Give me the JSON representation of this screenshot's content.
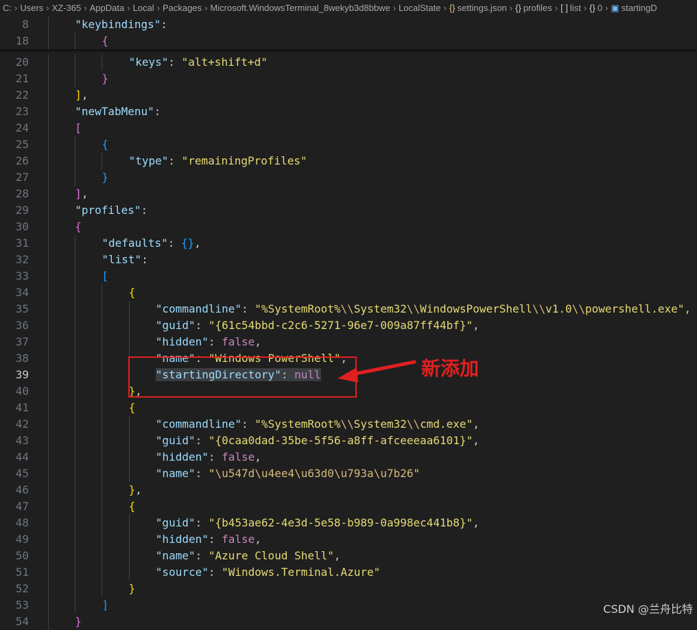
{
  "breadcrumb": {
    "items": [
      {
        "label": "C:",
        "icon": ""
      },
      {
        "label": "Users",
        "icon": ""
      },
      {
        "label": "XZ-365",
        "icon": ""
      },
      {
        "label": "AppData",
        "icon": ""
      },
      {
        "label": "Local",
        "icon": ""
      },
      {
        "label": "Packages",
        "icon": ""
      },
      {
        "label": "Microsoft.WindowsTerminal_8wekyb3d8bbwe",
        "icon": ""
      },
      {
        "label": "LocalState",
        "icon": ""
      },
      {
        "label": "settings.json",
        "icon": "json-file-icon"
      },
      {
        "label": "profiles",
        "icon": "object-icon"
      },
      {
        "label": "list",
        "icon": "array-icon"
      },
      {
        "label": "0",
        "icon": "object-icon"
      },
      {
        "label": "startingD",
        "icon": "property-icon"
      }
    ]
  },
  "sticky_lines": [
    {
      "number": "8",
      "indent": 1,
      "tokens": [
        {
          "t": "\"keybindings\"",
          "c": "k"
        },
        {
          "t": ":",
          "c": "p"
        }
      ]
    },
    {
      "number": "18",
      "indent": 2,
      "tokens": [
        {
          "t": "{",
          "c": "b2"
        }
      ]
    }
  ],
  "code_lines": [
    {
      "number": "20",
      "indent": 3,
      "tokens": [
        {
          "t": "\"keys\"",
          "c": "k"
        },
        {
          "t": ": ",
          "c": "p"
        },
        {
          "t": "\"alt+shift+d\"",
          "c": "s2"
        }
      ]
    },
    {
      "number": "21",
      "indent": 2,
      "tokens": [
        {
          "t": "}",
          "c": "b2"
        }
      ]
    },
    {
      "number": "22",
      "indent": 1,
      "tokens": [
        {
          "t": "]",
          "c": "b1"
        },
        {
          "t": ",",
          "c": "p"
        }
      ]
    },
    {
      "number": "23",
      "indent": 1,
      "tokens": [
        {
          "t": "\"newTabMenu\"",
          "c": "k"
        },
        {
          "t": ":",
          "c": "p"
        }
      ]
    },
    {
      "number": "24",
      "indent": 1,
      "tokens": [
        {
          "t": "[",
          "c": "b2"
        }
      ]
    },
    {
      "number": "25",
      "indent": 2,
      "tokens": [
        {
          "t": "{",
          "c": "b3"
        }
      ]
    },
    {
      "number": "26",
      "indent": 3,
      "tokens": [
        {
          "t": "\"type\"",
          "c": "k"
        },
        {
          "t": ": ",
          "c": "p"
        },
        {
          "t": "\"remainingProfiles\"",
          "c": "s2"
        }
      ]
    },
    {
      "number": "27",
      "indent": 2,
      "tokens": [
        {
          "t": "}",
          "c": "b3"
        }
      ]
    },
    {
      "number": "28",
      "indent": 1,
      "tokens": [
        {
          "t": "]",
          "c": "b2"
        },
        {
          "t": ",",
          "c": "p"
        }
      ]
    },
    {
      "number": "29",
      "indent": 1,
      "tokens": [
        {
          "t": "\"profiles\"",
          "c": "k"
        },
        {
          "t": ":",
          "c": "p"
        }
      ]
    },
    {
      "number": "30",
      "indent": 1,
      "tokens": [
        {
          "t": "{",
          "c": "b2"
        }
      ]
    },
    {
      "number": "31",
      "indent": 2,
      "tokens": [
        {
          "t": "\"defaults\"",
          "c": "k"
        },
        {
          "t": ": ",
          "c": "p"
        },
        {
          "t": "{}",
          "c": "b3"
        },
        {
          "t": ",",
          "c": "p"
        }
      ]
    },
    {
      "number": "32",
      "indent": 2,
      "tokens": [
        {
          "t": "\"list\"",
          "c": "k"
        },
        {
          "t": ":",
          "c": "p"
        }
      ]
    },
    {
      "number": "33",
      "indent": 2,
      "tokens": [
        {
          "t": "[",
          "c": "b3"
        }
      ]
    },
    {
      "number": "34",
      "indent": 3,
      "tokens": [
        {
          "t": "{",
          "c": "b1"
        }
      ]
    },
    {
      "number": "35",
      "indent": 4,
      "tokens": [
        {
          "t": "\"commandline\"",
          "c": "k"
        },
        {
          "t": ": ",
          "c": "p"
        },
        {
          "t": "\"%SystemRoot%",
          "c": "s2"
        },
        {
          "t": "\\\\",
          "c": "esc"
        },
        {
          "t": "System32",
          "c": "s2"
        },
        {
          "t": "\\\\",
          "c": "esc"
        },
        {
          "t": "WindowsPowerShell",
          "c": "s2"
        },
        {
          "t": "\\\\",
          "c": "esc"
        },
        {
          "t": "v1.0",
          "c": "s2"
        },
        {
          "t": "\\\\",
          "c": "esc"
        },
        {
          "t": "powershell.exe\",",
          "c": "s2"
        }
      ]
    },
    {
      "number": "36",
      "indent": 4,
      "tokens": [
        {
          "t": "\"guid\"",
          "c": "k"
        },
        {
          "t": ": ",
          "c": "p"
        },
        {
          "t": "\"{61c54bbd-c2c6-5271-96e7-009a87ff44bf}\"",
          "c": "s2"
        },
        {
          "t": ",",
          "c": "p"
        }
      ]
    },
    {
      "number": "37",
      "indent": 4,
      "tokens": [
        {
          "t": "\"hidden\"",
          "c": "k"
        },
        {
          "t": ": ",
          "c": "p"
        },
        {
          "t": "false",
          "c": "n"
        },
        {
          "t": ",",
          "c": "p"
        }
      ]
    },
    {
      "number": "38",
      "indent": 4,
      "tokens": [
        {
          "t": "\"name\"",
          "c": "k"
        },
        {
          "t": ": ",
          "c": "p"
        },
        {
          "t": "\"Windows PowerShell\"",
          "c": "s2"
        },
        {
          "t": ",",
          "c": "p"
        }
      ]
    },
    {
      "number": "39",
      "indent": 4,
      "active": true,
      "tokens": [
        {
          "t": "\"startingDirectory\"",
          "c": "k hl"
        },
        {
          "t": ": ",
          "c": "p hl"
        },
        {
          "t": "null",
          "c": "n hl"
        }
      ]
    },
    {
      "number": "40",
      "indent": 3,
      "tokens": [
        {
          "t": "}",
          "c": "b1"
        },
        {
          "t": ",",
          "c": "p"
        }
      ]
    },
    {
      "number": "41",
      "indent": 3,
      "tokens": [
        {
          "t": "{",
          "c": "b1"
        }
      ]
    },
    {
      "number": "42",
      "indent": 4,
      "tokens": [
        {
          "t": "\"commandline\"",
          "c": "k"
        },
        {
          "t": ": ",
          "c": "p"
        },
        {
          "t": "\"%SystemRoot%",
          "c": "s2"
        },
        {
          "t": "\\\\",
          "c": "esc"
        },
        {
          "t": "System32",
          "c": "s2"
        },
        {
          "t": "\\\\",
          "c": "esc"
        },
        {
          "t": "cmd.exe\"",
          "c": "s2"
        },
        {
          "t": ",",
          "c": "p"
        }
      ]
    },
    {
      "number": "43",
      "indent": 4,
      "tokens": [
        {
          "t": "\"guid\"",
          "c": "k"
        },
        {
          "t": ": ",
          "c": "p"
        },
        {
          "t": "\"{0caa0dad-35be-5f56-a8ff-afceeeaa6101}\"",
          "c": "s2"
        },
        {
          "t": ",",
          "c": "p"
        }
      ]
    },
    {
      "number": "44",
      "indent": 4,
      "tokens": [
        {
          "t": "\"hidden\"",
          "c": "k"
        },
        {
          "t": ": ",
          "c": "p"
        },
        {
          "t": "false",
          "c": "n"
        },
        {
          "t": ",",
          "c": "p"
        }
      ]
    },
    {
      "number": "45",
      "indent": 4,
      "tokens": [
        {
          "t": "\"name\"",
          "c": "k"
        },
        {
          "t": ": ",
          "c": "p"
        },
        {
          "t": "\"",
          "c": "s2"
        },
        {
          "t": "\\u547d\\u4ee4\\u63d0\\u793a\\u7b26",
          "c": "esc"
        },
        {
          "t": "\"",
          "c": "s2"
        }
      ]
    },
    {
      "number": "46",
      "indent": 3,
      "tokens": [
        {
          "t": "}",
          "c": "b1"
        },
        {
          "t": ",",
          "c": "p"
        }
      ]
    },
    {
      "number": "47",
      "indent": 3,
      "tokens": [
        {
          "t": "{",
          "c": "b1"
        }
      ]
    },
    {
      "number": "48",
      "indent": 4,
      "tokens": [
        {
          "t": "\"guid\"",
          "c": "k"
        },
        {
          "t": ": ",
          "c": "p"
        },
        {
          "t": "\"{b453ae62-4e3d-5e58-b989-0a998ec441b8}\"",
          "c": "s2"
        },
        {
          "t": ",",
          "c": "p"
        }
      ]
    },
    {
      "number": "49",
      "indent": 4,
      "tokens": [
        {
          "t": "\"hidden\"",
          "c": "k"
        },
        {
          "t": ": ",
          "c": "p"
        },
        {
          "t": "false",
          "c": "n"
        },
        {
          "t": ",",
          "c": "p"
        }
      ]
    },
    {
      "number": "50",
      "indent": 4,
      "tokens": [
        {
          "t": "\"name\"",
          "c": "k"
        },
        {
          "t": ": ",
          "c": "p"
        },
        {
          "t": "\"Azure Cloud Shell\"",
          "c": "s2"
        },
        {
          "t": ",",
          "c": "p"
        }
      ]
    },
    {
      "number": "51",
      "indent": 4,
      "tokens": [
        {
          "t": "\"source\"",
          "c": "k"
        },
        {
          "t": ": ",
          "c": "p"
        },
        {
          "t": "\"Windows.Terminal.Azure\"",
          "c": "s2"
        }
      ]
    },
    {
      "number": "52",
      "indent": 3,
      "tokens": [
        {
          "t": "}",
          "c": "b1"
        }
      ]
    },
    {
      "number": "53",
      "indent": 2,
      "tokens": [
        {
          "t": "]",
          "c": "b3"
        }
      ]
    },
    {
      "number": "54",
      "indent": 1,
      "tokens": [
        {
          "t": "}",
          "c": "b2"
        }
      ]
    }
  ],
  "annotation": {
    "label": "新添加",
    "color": "#e02020"
  },
  "watermark": "CSDN @兰舟比特"
}
